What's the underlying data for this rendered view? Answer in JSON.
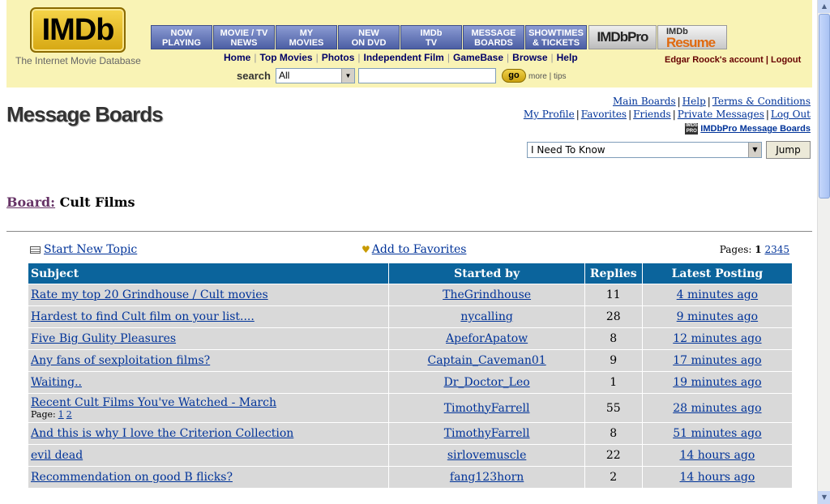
{
  "header": {
    "logo": "IMDb",
    "tagline": "The Internet Movie Database",
    "tabs": [
      "NOW\nPLAYING",
      "MOVIE / TV\nNEWS",
      "MY\nMOVIES",
      "NEW\nON DVD",
      "IMDb\nTV",
      "MESSAGE\nBOARDS",
      "SHOWTIMES\n& TICKETS"
    ],
    "pro_label": "IMDbPro",
    "resume_top": "IMDb",
    "resume_bottom": "Resume",
    "subnav": [
      "Home",
      "Top Movies",
      "Photos",
      "Independent Film",
      "GameBase",
      "Browse",
      "Help"
    ],
    "account_name": "Edgar Roock's account",
    "logout": "Logout",
    "search_label": "search",
    "search_scope": "All",
    "go": "go",
    "more": "more",
    "tips": "tips"
  },
  "page": {
    "title": "Message Boards",
    "links_row1": [
      "Main Boards",
      "Help",
      "Terms & Conditions"
    ],
    "links_row2": [
      "My Profile",
      "Favorites",
      "Friends",
      "Private Messages",
      "Log Out"
    ],
    "pro_boards": "IMDbPro Message Boards",
    "pro_icon": "IMDb PRO",
    "jump_value": "I Need To Know",
    "jump_button": "Jump",
    "board_label": "Board:",
    "board_name": "Cult Films"
  },
  "board": {
    "start_topic": "Start New Topic",
    "add_favorites": "Add to Favorites",
    "pages_label": "Pages:",
    "pages": [
      "1",
      "2",
      "3",
      "4",
      "5"
    ],
    "columns": [
      "Subject",
      "Started by",
      "Replies",
      "Latest Posting"
    ],
    "topics": [
      {
        "subject": "Rate my top 20 Grindhouse / Cult movies",
        "author": "TheGrindhouse",
        "replies": "11",
        "latest": "4 minutes ago"
      },
      {
        "subject": "Hardest to find Cult film on your list....",
        "author": "nycalling",
        "replies": "28",
        "latest": "9 minutes ago"
      },
      {
        "subject": "Five Big Gulity Pleasures",
        "author": "ApeforApatow",
        "replies": "8",
        "latest": "12 minutes ago"
      },
      {
        "subject": "Any fans of sexploitation films?",
        "author": "Captain_Caveman01",
        "replies": "9",
        "latest": "17 minutes ago"
      },
      {
        "subject": "Waiting..",
        "author": "Dr_Doctor_Leo",
        "replies": "1",
        "latest": "19 minutes ago"
      },
      {
        "subject": "Recent Cult Films You've Watched - March",
        "author": "TimothyFarrell",
        "replies": "55",
        "latest": "28 minutes ago",
        "page_label": "Page:",
        "sub_pages": [
          "1",
          "2"
        ]
      },
      {
        "subject": "And this is why I love the Criterion Collection",
        "author": "TimothyFarrell",
        "replies": "8",
        "latest": "51 minutes ago"
      },
      {
        "subject": "evil dead",
        "author": "sirlovemuscle",
        "replies": "22",
        "latest": "14 hours ago"
      },
      {
        "subject": "Recommendation on good B flicks?",
        "author": "fang123horn",
        "replies": "2",
        "latest": "14 hours ago"
      }
    ]
  },
  "icons": {
    "start_topic": "document-icon",
    "favorites": "heart-plus-icon",
    "dropdown": "chevron-down-icon"
  },
  "colors": {
    "header_bg": "#f9f3b5",
    "tab_bg": "#5b6fb0",
    "table_header": "#0b649c",
    "row_bg": "#d9d9d9",
    "link": "#003399"
  }
}
